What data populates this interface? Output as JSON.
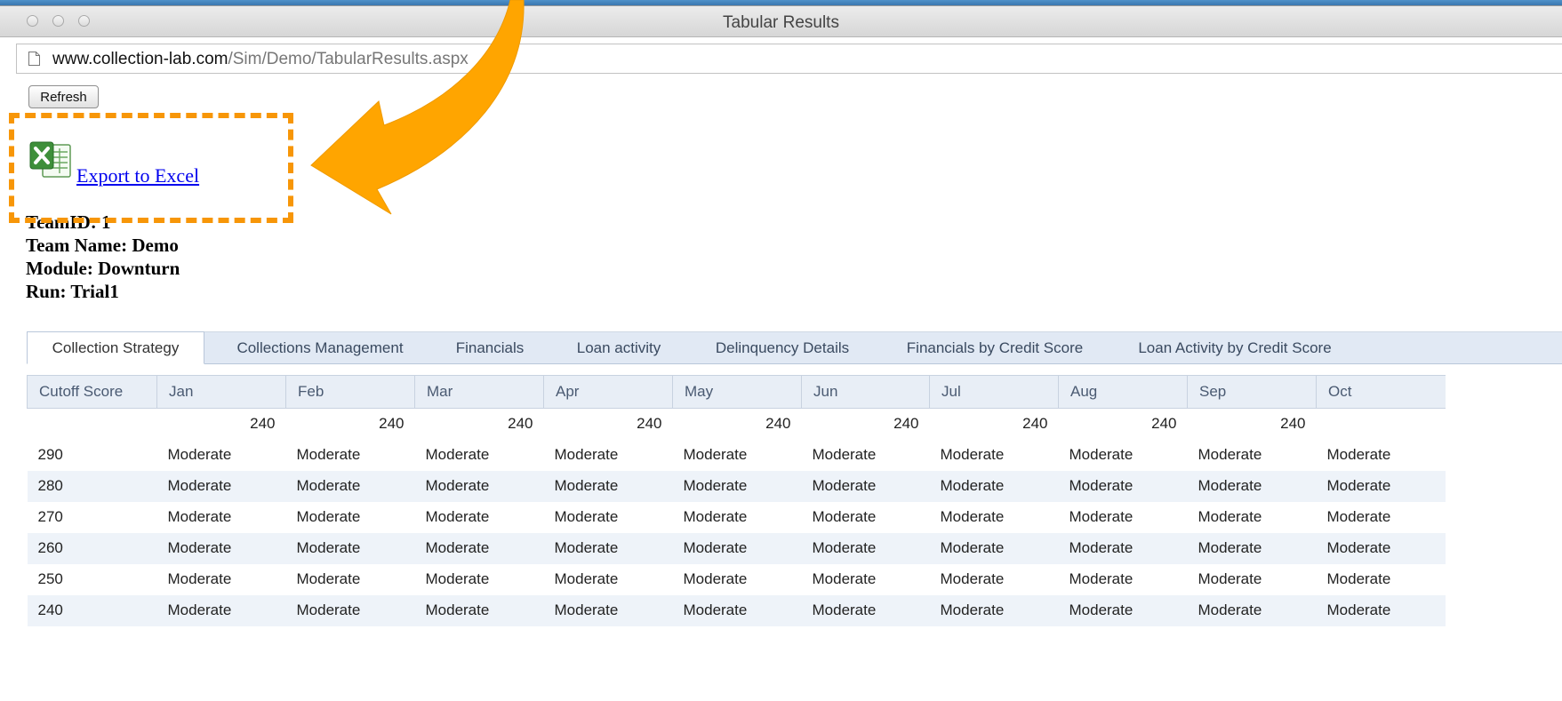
{
  "window": {
    "title": "Tabular Results"
  },
  "address_bar": {
    "host": "www.collection-lab.com",
    "path": "/Sim/Demo/TabularResults.aspx"
  },
  "page": {
    "refresh_label": "Refresh",
    "export_label": "Export to Excel",
    "excel_icon": "excel-icon",
    "info": {
      "team_id": "TeamID: 1",
      "team_name": "Team Name: Demo",
      "module": "Module: Downturn",
      "run": "Run: Trial1"
    }
  },
  "annotation": {
    "highlight_color": "#f79608"
  },
  "tabs": [
    {
      "label": "Collection Strategy",
      "active": true
    },
    {
      "label": "Collections Management"
    },
    {
      "label": "Financials"
    },
    {
      "label": "Loan activity"
    },
    {
      "label": "Delinquency Details"
    },
    {
      "label": "Financials by Credit Score"
    },
    {
      "label": "Loan Activity by Credit Score"
    }
  ],
  "table": {
    "headers": [
      "Cutoff Score",
      "Jan",
      "Feb",
      "Mar",
      "Apr",
      "May",
      "Jun",
      "Jul",
      "Aug",
      "Sep",
      "Oct"
    ],
    "cutoff_row": [
      "",
      "240",
      "240",
      "240",
      "240",
      "240",
      "240",
      "240",
      "240",
      "240",
      ""
    ],
    "rows": [
      [
        "290",
        "Moderate",
        "Moderate",
        "Moderate",
        "Moderate",
        "Moderate",
        "Moderate",
        "Moderate",
        "Moderate",
        "Moderate",
        "Moderate"
      ],
      [
        "280",
        "Moderate",
        "Moderate",
        "Moderate",
        "Moderate",
        "Moderate",
        "Moderate",
        "Moderate",
        "Moderate",
        "Moderate",
        "Moderate"
      ],
      [
        "270",
        "Moderate",
        "Moderate",
        "Moderate",
        "Moderate",
        "Moderate",
        "Moderate",
        "Moderate",
        "Moderate",
        "Moderate",
        "Moderate"
      ],
      [
        "260",
        "Moderate",
        "Moderate",
        "Moderate",
        "Moderate",
        "Moderate",
        "Moderate",
        "Moderate",
        "Moderate",
        "Moderate",
        "Moderate"
      ],
      [
        "250",
        "Moderate",
        "Moderate",
        "Moderate",
        "Moderate",
        "Moderate",
        "Moderate",
        "Moderate",
        "Moderate",
        "Moderate",
        "Moderate"
      ],
      [
        "240",
        "Moderate",
        "Moderate",
        "Moderate",
        "Moderate",
        "Moderate",
        "Moderate",
        "Moderate",
        "Moderate",
        "Moderate",
        "Moderate"
      ]
    ]
  }
}
